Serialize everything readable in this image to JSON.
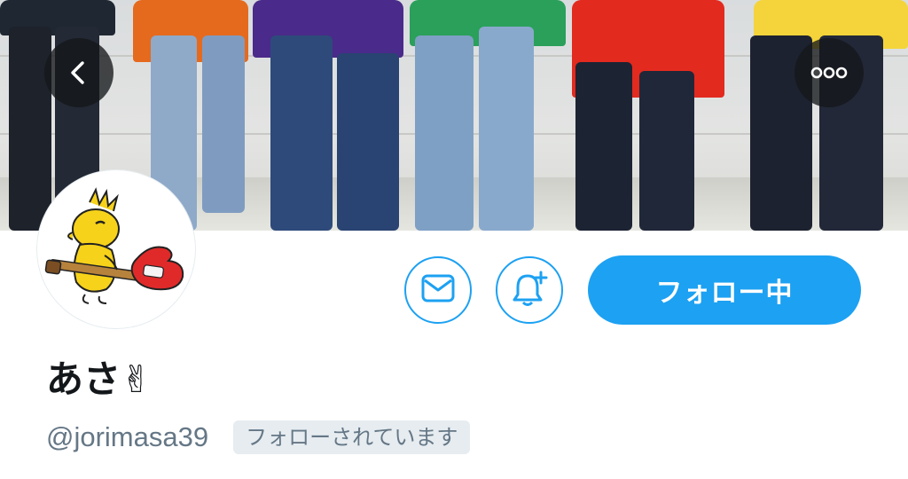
{
  "header": {
    "back_icon": "chevron-left-icon",
    "more_icon": "more-horizontal-icon"
  },
  "profile": {
    "display_name": "あさ✌",
    "handle": "@jorimasa39",
    "follows_you_label": "フォローされています",
    "avatar_icon": "bird-with-guitar-icon"
  },
  "actions": {
    "message_icon": "envelope-icon",
    "notify_icon": "bell-plus-icon",
    "follow_label": "フォロー中"
  },
  "colors": {
    "accent": "#1da1f2",
    "secondary_text": "#657786",
    "primary_text": "#14171a",
    "badge_bg": "#e6ecf0"
  }
}
